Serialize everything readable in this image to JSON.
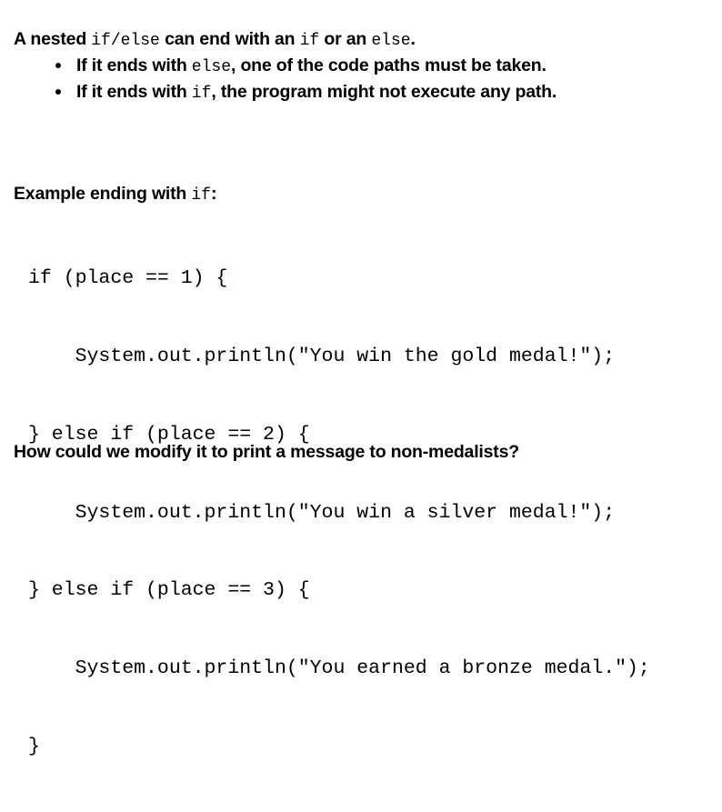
{
  "slide": {
    "background_color": "#ffffff",
    "text_color": "#000000",
    "intro": {
      "lead_parts": {
        "p1": "A nested ",
        "code1": "if/else",
        "p2": " can end with an ",
        "code2": "if",
        "p3": " or an ",
        "code3": "else",
        "p4": "."
      },
      "bullets": [
        {
          "p1": "If it ends with ",
          "code1": "else",
          "p2": ", one of the code paths must be taken.",
          "code2": "",
          "p3": ""
        },
        {
          "p1": "If it ends with ",
          "code1": "if",
          "p2": ", the program might not execute any path.",
          "code2": "",
          "p3": ""
        }
      ]
    },
    "example_caption": {
      "p1": "Example ending with ",
      "code1": "if",
      "p2": ":"
    },
    "code_block": {
      "language": "java",
      "lines": [
        "if (place == 1) {",
        "    System.out.println(\"You win the gold medal!\");",
        "} else if (place == 2) {",
        "    System.out.println(\"You win a silver medal!\");",
        "} else if (place == 3) {",
        "    System.out.println(\"You earned a bronze medal.\");",
        "}"
      ]
    },
    "closing_question": "How could we modify it to print a message to non-medalists?"
  }
}
